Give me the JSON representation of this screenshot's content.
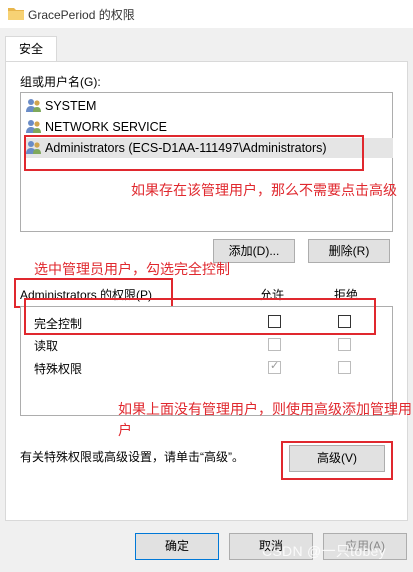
{
  "window": {
    "title": "GracePeriod 的权限",
    "icon": "folder-icon"
  },
  "tab": {
    "label": "安全"
  },
  "groups": {
    "label": "组或用户名(G):",
    "users": [
      {
        "name": "SYSTEM",
        "icon": "users-icon"
      },
      {
        "name": "NETWORK SERVICE",
        "icon": "users-icon"
      },
      {
        "name": "Administrators (ECS-D1AA-111497\\Administrators)",
        "icon": "users-icon",
        "selected": true
      }
    ]
  },
  "annotations": {
    "note1": "如果存在该管理用户，那么不需要点击高级",
    "note2": "选中管理员用户，勾选完全控制",
    "note3": "如果上面没有管理用户，则使用高级添加管理用户",
    "color": "#e0282e"
  },
  "buttons": {
    "add": "添加(D)...",
    "remove": "删除(R)",
    "advanced": "高级(V)",
    "ok": "确定",
    "cancel": "取消",
    "apply": "应用(A)"
  },
  "permissions": {
    "label": "Administrators 的权限(P)",
    "allow_header": "允许",
    "deny_header": "拒绝",
    "rows": [
      {
        "name": "完全控制",
        "allow": false,
        "deny": false,
        "enabled": true
      },
      {
        "name": "读取",
        "allow": false,
        "deny": false,
        "enabled": false
      },
      {
        "name": "特殊权限",
        "allow": true,
        "deny": false,
        "enabled": false
      }
    ]
  },
  "advanced_hint": "有关特殊权限或高级设置，请单击“高级”。",
  "watermark": "CSDN @一只tobey"
}
